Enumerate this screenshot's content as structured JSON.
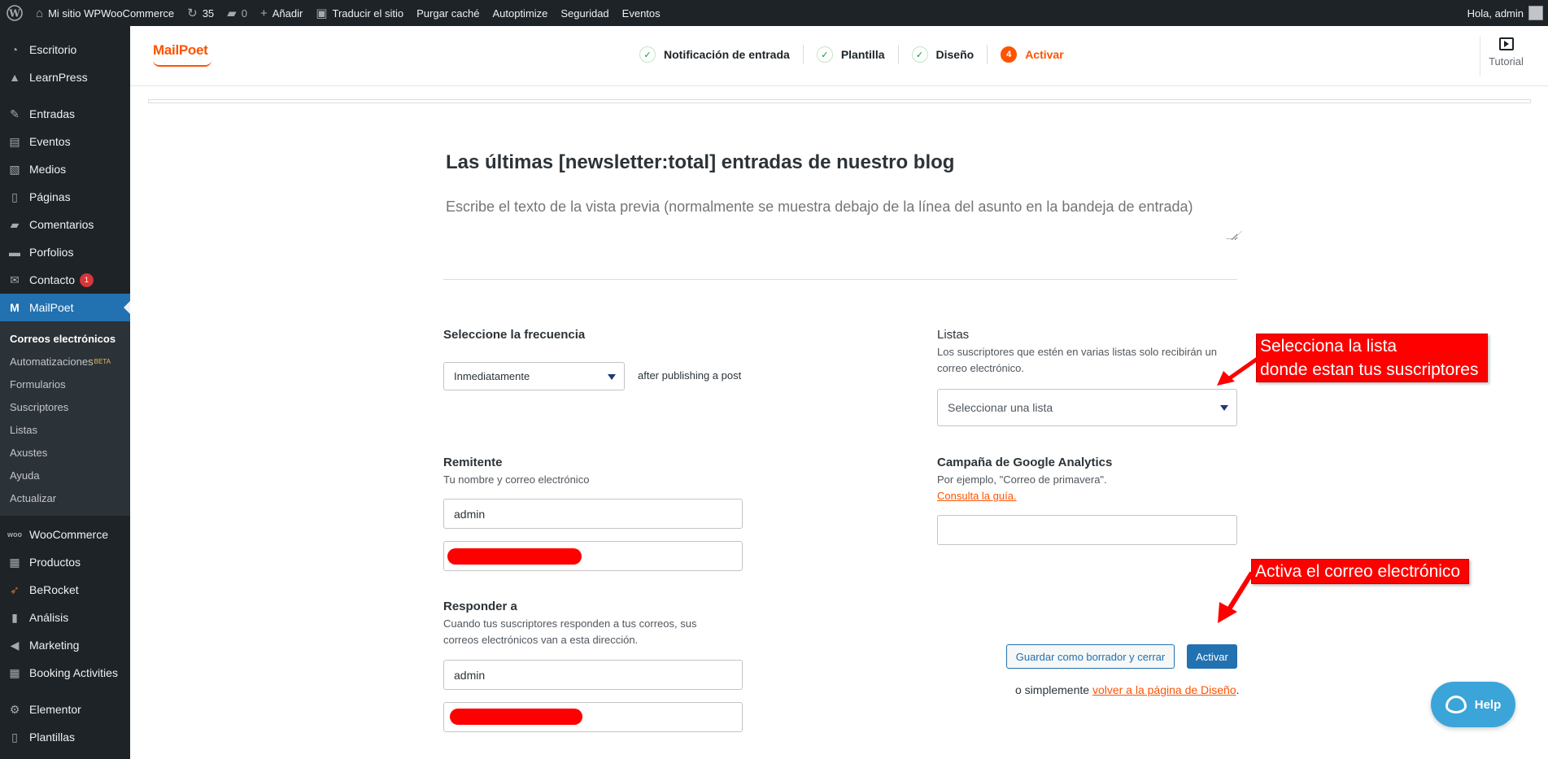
{
  "adminbar": {
    "site_name": "Mi sitio WPWooCommerce",
    "updates_count": "35",
    "comments_count": "0",
    "add_new": "Añadir",
    "translate": "Traducir el sitio",
    "purge_cache": "Purgar caché",
    "autoptimize": "Autoptimize",
    "security": "Seguridad",
    "events": "Eventos",
    "greeting": "Hola, admin"
  },
  "sidebar": {
    "items": [
      {
        "label": "Escritorio",
        "icon": "dashboard-icon"
      },
      {
        "label": "LearnPress",
        "icon": "graduation-cap-icon"
      },
      {
        "label": "Entradas",
        "icon": "pin-icon"
      },
      {
        "label": "Eventos",
        "icon": "calendar-icon"
      },
      {
        "label": "Medios",
        "icon": "media-icon"
      },
      {
        "label": "Páginas",
        "icon": "pages-icon"
      },
      {
        "label": "Comentarios",
        "icon": "comment-icon"
      },
      {
        "label": "Porfolios",
        "icon": "folder-icon"
      },
      {
        "label": "Contacto",
        "icon": "mail-icon",
        "badge": "1"
      },
      {
        "label": "MailPoet",
        "icon": "mailpoet-icon"
      }
    ],
    "submenu": [
      {
        "label": "Correos electrónicos"
      },
      {
        "label": "Automatizaciones",
        "sup": "BETA"
      },
      {
        "label": "Formularios"
      },
      {
        "label": "Suscriptores"
      },
      {
        "label": "Listas"
      },
      {
        "label": "Axustes"
      },
      {
        "label": "Ayuda"
      },
      {
        "label": "Actualizar"
      }
    ],
    "items_after": [
      {
        "label": "WooCommerce",
        "icon": "woo-icon"
      },
      {
        "label": "Productos",
        "icon": "archive-icon"
      },
      {
        "label": "BeRocket",
        "icon": "rocket-icon"
      },
      {
        "label": "Análisis",
        "icon": "bar-chart-icon"
      },
      {
        "label": "Marketing",
        "icon": "megaphone-icon"
      },
      {
        "label": "Booking Activities",
        "icon": "calendar-grid-icon"
      },
      {
        "label": "Elementor",
        "icon": "gear-icon"
      },
      {
        "label": "Plantillas",
        "icon": "templates-icon"
      }
    ]
  },
  "wizard": {
    "logo": "MailPoet",
    "steps": [
      {
        "label": "Notificación de entrada",
        "state": "done"
      },
      {
        "label": "Plantilla",
        "state": "done"
      },
      {
        "label": "Diseño",
        "state": "done"
      },
      {
        "label": "Activar",
        "state": "current",
        "number": "4"
      }
    ],
    "tutorial": "Tutorial"
  },
  "main": {
    "subject": "Las últimas [newsletter:total] entradas de nuestro blog",
    "preview_placeholder": "Escribe el texto de la vista previa (normalmente se muestra debajo de la línea del asunto en la bandeja de entrada)",
    "frequency": {
      "label": "Seleccione la frecuencia",
      "value": "Inmediatamente",
      "suffix": "after publishing a post"
    },
    "lists": {
      "label": "Listas",
      "help": "Los suscriptores que estén en varias listas solo recibirán un correo electrónico.",
      "placeholder": "Seleccionar una lista"
    },
    "sender": {
      "label": "Remitente",
      "help": "Tu nombre y correo electrónico",
      "name_value": "admin"
    },
    "analytics": {
      "label": "Campaña de Google Analytics",
      "help": "Por ejemplo, \"Correo de primavera\".",
      "link": "Consulta la guía."
    },
    "reply_to": {
      "label": "Responder a",
      "help": "Cuando tus suscriptores responden a tus correos, sus correos electrónicos van a esta dirección.",
      "name_value": "admin"
    },
    "save_draft": "Guardar como borrador y cerrar",
    "activate": "Activar",
    "or_text": "o simplemente",
    "back_link": "volver a la página de Diseño",
    "period": "."
  },
  "annotations": {
    "list_callout": [
      "Selecciona la lista",
      "donde estan tus suscriptores"
    ],
    "activate_callout": "Activa el correo electrónico",
    "color": "#ff0000"
  },
  "help_button": "Help"
}
